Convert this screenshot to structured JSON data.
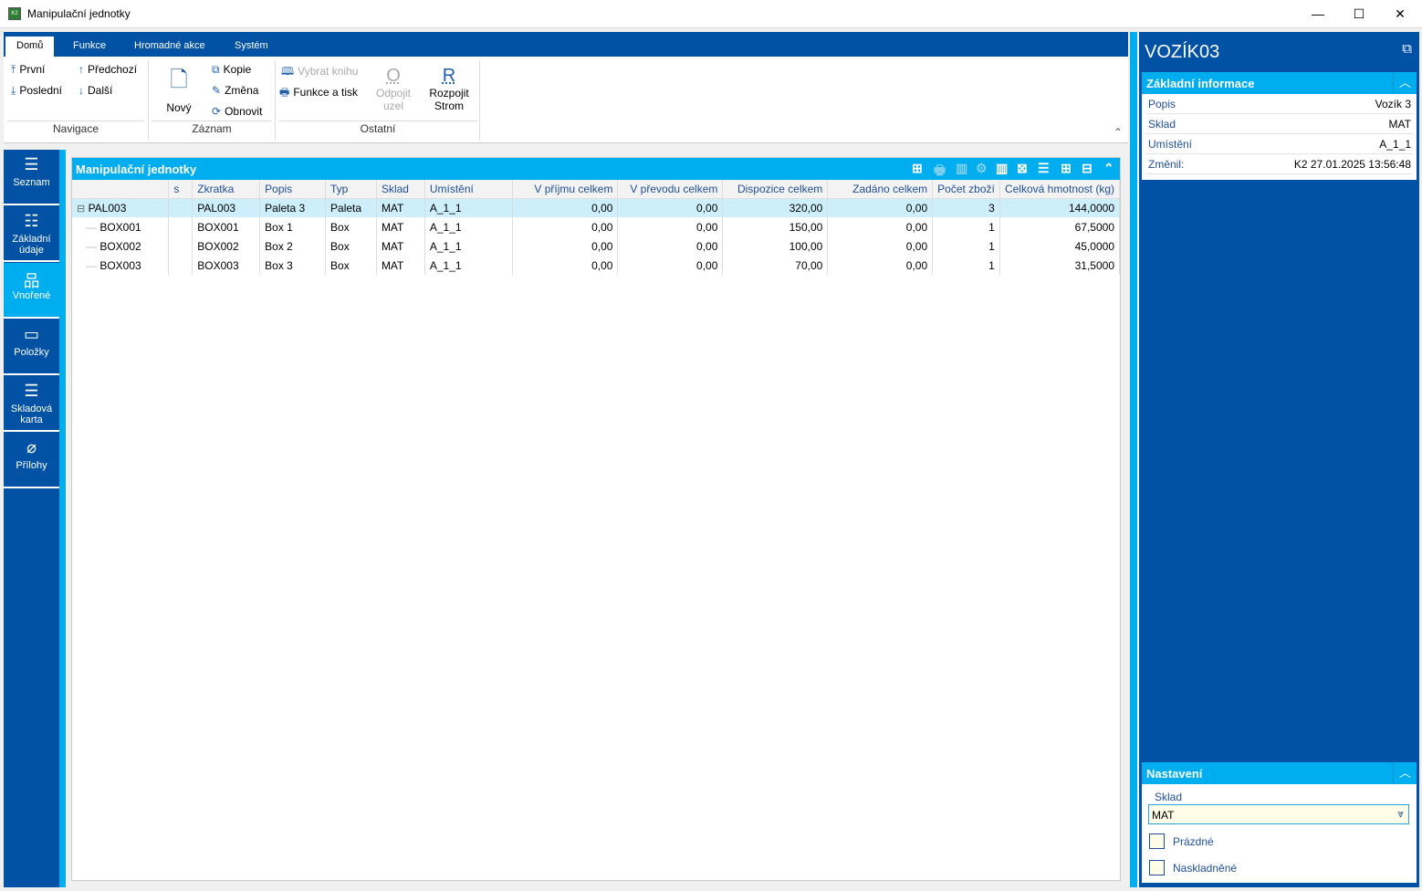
{
  "window": {
    "title": "Manipulační jednotky",
    "app_icon": "K2",
    "minimize": "—",
    "maximize": "☐",
    "close": "✕"
  },
  "ribbon": {
    "tabs": [
      {
        "label": "Domů",
        "active": true
      },
      {
        "label": "Funkce"
      },
      {
        "label": "Hromadné akce"
      },
      {
        "label": "Systém"
      }
    ],
    "navigace": {
      "label": "Navigace",
      "first": "První",
      "last": "Poslední",
      "prev": "Předchozí",
      "next": "Další"
    },
    "zaznam": {
      "label": "Záznam",
      "new": "Nový",
      "copy": "Kopie",
      "edit": "Změna",
      "refresh": "Obnovit"
    },
    "ostatni": {
      "label": "Ostatní",
      "select_book": "Vybrat knihu",
      "print": "Funkce a tisk",
      "detach_1": "Odpojit",
      "detach_2": "uzel",
      "split_1": "Rozpojit",
      "split_2": "Strom"
    },
    "collapse": "⌃"
  },
  "leftnav": [
    {
      "label": "Seznam",
      "icon": "list-icon",
      "glyph": "☰"
    },
    {
      "label": "Základní údaje",
      "icon": "bullet-list-icon",
      "glyph": "☷"
    },
    {
      "label": "Vnořené",
      "icon": "hierarchy-icon",
      "glyph": "品",
      "active": true
    },
    {
      "label": "Položky",
      "icon": "box-icon",
      "glyph": "▭"
    },
    {
      "label": "Skladová karta",
      "icon": "list-icon",
      "glyph": "☰"
    },
    {
      "label": "Přílohy",
      "icon": "paperclip-icon",
      "glyph": "⌀"
    }
  ],
  "grid": {
    "title": "Manipulační jednotky",
    "columns": [
      {
        "label": ""
      },
      {
        "label": "s"
      },
      {
        "label": "Zkratka"
      },
      {
        "label": "Popis"
      },
      {
        "label": "Typ"
      },
      {
        "label": "Sklad"
      },
      {
        "label": "Umístění"
      },
      {
        "label": "V příjmu celkem",
        "align": "r"
      },
      {
        "label": "V převodu celkem",
        "align": "r"
      },
      {
        "label": "Dispozice celkem",
        "align": "r"
      },
      {
        "label": "Zadáno celkem",
        "align": "r"
      },
      {
        "label": "Počet zboží",
        "align": "r"
      },
      {
        "label": "Celková hmotnost (kg)",
        "align": "r"
      }
    ],
    "rows": [
      {
        "tree": "PAL003",
        "expanded": true,
        "cells": [
          "",
          "PAL003",
          "Paleta 3",
          "Paleta",
          "MAT",
          "A_1_1",
          "0,00",
          "0,00",
          "320,00",
          "0,00",
          "3",
          "144,0000"
        ],
        "selected": true
      },
      {
        "tree": "BOX001",
        "cells": [
          "",
          "BOX001",
          "Box 1",
          "Box",
          "MAT",
          "A_1_1",
          "0,00",
          "0,00",
          "150,00",
          "0,00",
          "1",
          "67,5000"
        ]
      },
      {
        "tree": "BOX002",
        "cells": [
          "",
          "BOX002",
          "Box 2",
          "Box",
          "MAT",
          "A_1_1",
          "0,00",
          "0,00",
          "100,00",
          "0,00",
          "1",
          "45,0000"
        ]
      },
      {
        "tree": "BOX003",
        "cells": [
          "",
          "BOX003",
          "Box 3",
          "Box",
          "MAT",
          "A_1_1",
          "0,00",
          "0,00",
          "70,00",
          "0,00",
          "1",
          "31,5000"
        ]
      }
    ]
  },
  "rightpanel": {
    "title": "VOZÍK03",
    "basic": {
      "header": "Základní informace",
      "rows": [
        {
          "label": "Popis",
          "value": "Vozík 3"
        },
        {
          "label": "Sklad",
          "value": "MAT"
        },
        {
          "label": "Umístění",
          "value": "A_1_1"
        },
        {
          "label": "Změnil:",
          "value": "K2 27.01.2025 13:56:48"
        }
      ]
    },
    "settings": {
      "header": "Nastavení",
      "sklad_label": "Sklad",
      "sklad_value": "MAT",
      "empty_label": "Prázdné",
      "empty_checked": false,
      "stocked_label": "Naskladněné",
      "stocked_checked": false
    }
  }
}
